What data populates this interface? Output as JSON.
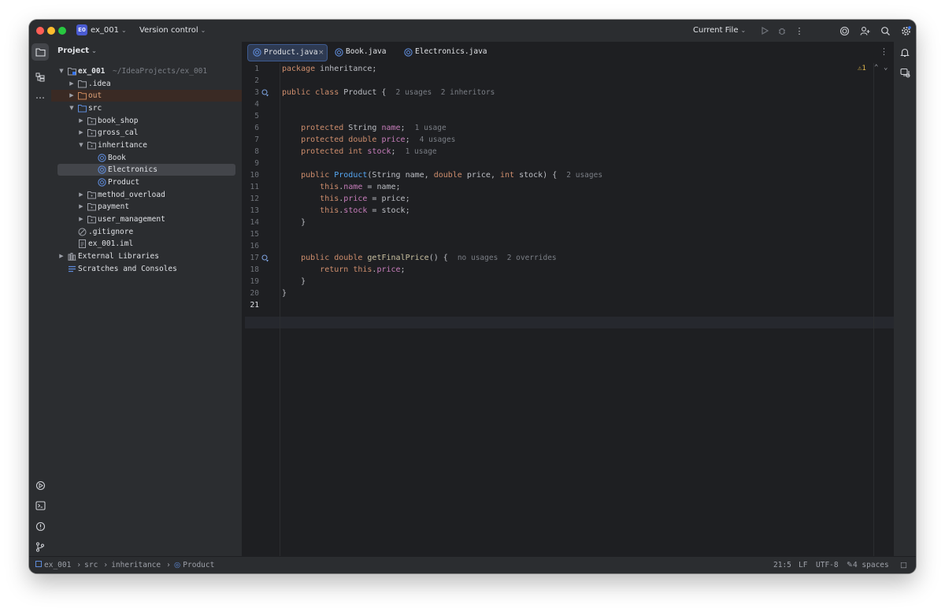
{
  "titlebar": {
    "project_badge": "E0",
    "project_name": "ex_001",
    "version_control": "Version control",
    "run_config": "Current File"
  },
  "panel": {
    "title": "Project",
    "root": {
      "name": "ex_001",
      "path": "~/IdeaProjects/ex_001"
    },
    "items": [
      {
        "label": ".idea"
      },
      {
        "label": "out"
      },
      {
        "label": "src"
      },
      {
        "label": "book_shop"
      },
      {
        "label": "gross_cal"
      },
      {
        "label": "inheritance"
      },
      {
        "label": "Book"
      },
      {
        "label": "Electronics"
      },
      {
        "label": "Product"
      },
      {
        "label": "method_overload"
      },
      {
        "label": "payment"
      },
      {
        "label": "user_management"
      },
      {
        "label": ".gitignore"
      },
      {
        "label": "ex_001.iml"
      },
      {
        "label": "External Libraries"
      },
      {
        "label": "Scratches and Consoles"
      }
    ]
  },
  "tabs": [
    {
      "label": "Product.java",
      "active": true
    },
    {
      "label": "Book.java"
    },
    {
      "label": "Electronics.java"
    }
  ],
  "editor": {
    "warning_count": "1",
    "line_numbers": [
      "1",
      "2",
      "3",
      "4",
      "5",
      "6",
      "7",
      "8",
      "9",
      "10",
      "11",
      "12",
      "13",
      "14",
      "15",
      "16",
      "17",
      "18",
      "19",
      "20",
      "21"
    ],
    "code": {
      "l1_kw": "package",
      "l1_rest": " inheritance;",
      "l3_kw": "public class",
      "l3_rest": " Product {",
      "l3_hint": "2 usages  2 inheritors",
      "l6_kw": "protected",
      "l6_type": " String ",
      "l6_field": "name",
      "l6_end": ";",
      "l6_hint": "1 usage",
      "l7_kw": "protected double",
      "l7_sp": " ",
      "l7_field": "price",
      "l7_end": ";",
      "l7_hint": "4 usages",
      "l8_kw": "protected int",
      "l8_sp": " ",
      "l8_field": "stock",
      "l8_end": ";",
      "l8_hint": "1 usage",
      "l10_kw": "public",
      "l10_sp": " ",
      "l10_fn": "Product",
      "l10_a": "(String name, ",
      "l10_kw2": "double",
      "l10_b": " price, ",
      "l10_kw3": "int",
      "l10_c": " stock) {",
      "l10_hint": "2 usages",
      "l11_kw": "this",
      "l11_dot": ".",
      "l11_field": "name",
      "l11_rest": " = name;",
      "l12_kw": "this",
      "l12_dot": ".",
      "l12_field": "price",
      "l12_rest": " = price;",
      "l13_kw": "this",
      "l13_dot": ".",
      "l13_field": "stock",
      "l13_rest": " = stock;",
      "l14": "}",
      "l17_kw": "public double",
      "l17_sp": " ",
      "l17_fn": "getFinalPrice",
      "l17_rest": "() {",
      "l17_hint": "no usages  2 overrides",
      "l18_kw": "return this",
      "l18_dot": ".",
      "l18_field": "price",
      "l18_rest": ";",
      "l19": "}",
      "l20": "}"
    }
  },
  "statusbar": {
    "crumbs": [
      "ex_001",
      "src",
      "inheritance",
      "Product"
    ],
    "position": "21:5",
    "line_ending": "LF",
    "encoding": "UTF-8",
    "indent": "4 spaces"
  },
  "colors": {
    "background": "#1e1f22",
    "panel": "#2b2d30",
    "keyword": "#cf8e6d",
    "field": "#c77dbb",
    "function": "#56a8f5",
    "accent": "#3574f0"
  }
}
